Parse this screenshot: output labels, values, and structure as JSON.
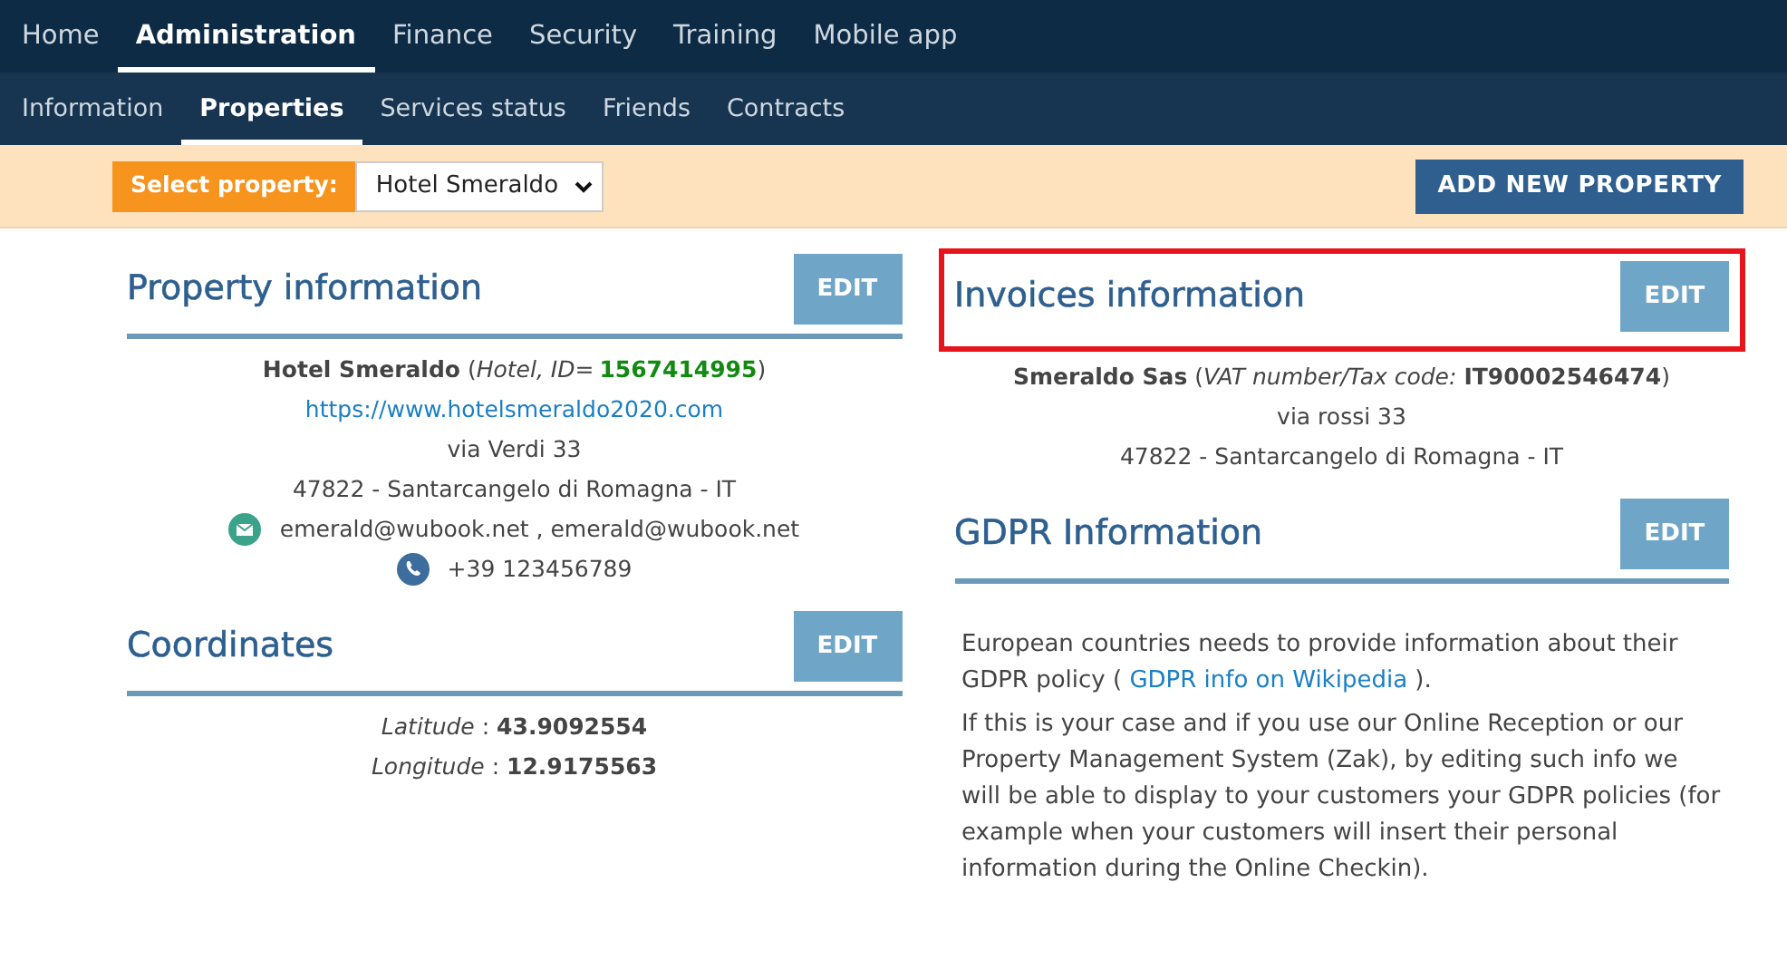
{
  "main_nav": [
    {
      "label": "Home",
      "selected": false
    },
    {
      "label": "Administration",
      "selected": true
    },
    {
      "label": "Finance",
      "selected": false
    },
    {
      "label": "Security",
      "selected": false
    },
    {
      "label": "Training",
      "selected": false
    },
    {
      "label": "Mobile app",
      "selected": false
    }
  ],
  "sub_nav": [
    {
      "label": "Information",
      "selected": false
    },
    {
      "label": "Properties",
      "selected": true
    },
    {
      "label": "Services status",
      "selected": false
    },
    {
      "label": "Friends",
      "selected": false
    },
    {
      "label": "Contracts",
      "selected": false
    }
  ],
  "property_bar": {
    "label": "Select property:",
    "value": "Hotel Smeraldo",
    "add_button": "ADD NEW PROPERTY"
  },
  "left_sections": [
    {
      "title": "Property information",
      "edit": "EDIT",
      "highlighted": false,
      "lines": [
        {
          "kind": "segments",
          "segments": [
            {
              "kind": "bold",
              "text": "Hotel Smeraldo"
            },
            {
              "kind": "plain",
              "text": " ("
            },
            {
              "kind": "italic",
              "text": "Hotel, ID="
            },
            {
              "kind": "id",
              "text": "1567414995"
            },
            {
              "kind": "plain",
              "text": ")"
            }
          ]
        },
        {
          "kind": "link",
          "text": "https://www.hotelsmeraldo2020.com"
        },
        {
          "kind": "text",
          "text": "via Verdi 33"
        },
        {
          "kind": "text",
          "text": "47822 - Santarcangelo di Romagna - IT"
        },
        {
          "kind": "email",
          "text": "emerald@wubook.net , emerald@wubook.net"
        },
        {
          "kind": "phone",
          "text": "+39 123456789"
        }
      ]
    },
    {
      "title": "Coordinates",
      "edit": "EDIT",
      "highlighted": false,
      "lines": [
        {
          "kind": "rich",
          "text": "*Latitude* : **43.9092554**"
        },
        {
          "kind": "rich",
          "text": "*Longitude* : **12.9175563**"
        }
      ]
    }
  ],
  "right_sections": [
    {
      "title": "Invoices information",
      "edit": "EDIT",
      "highlighted": true,
      "lines": [
        {
          "kind": "rich",
          "text": "**Smeraldo Sas** (*VAT number/Tax code:* **IT90002546474**)"
        },
        {
          "kind": "text",
          "text": "via rossi 33"
        },
        {
          "kind": "text",
          "text": "47822 - Santarcangelo di Romagna - IT"
        }
      ]
    },
    {
      "title": "GDPR Information",
      "edit": "EDIT",
      "highlighted": false,
      "lines": [
        {
          "kind": "paragraph",
          "segments": [
            {
              "kind": "plain",
              "text": "European countries needs to provide information about their GDPR policy ( "
            },
            {
              "kind": "link",
              "text": "GDPR info on Wikipedia"
            },
            {
              "kind": "plain",
              "text": " )."
            }
          ]
        },
        {
          "kind": "paragraph",
          "segments": [
            {
              "kind": "plain",
              "text": "If this is your case and if you use our Online Reception or our Property Management System (Zak), by editing such info we will be able to display to your customers your GDPR policies (for example when your customers will insert their personal information during the Online Checkin)."
            }
          ]
        }
      ]
    }
  ]
}
